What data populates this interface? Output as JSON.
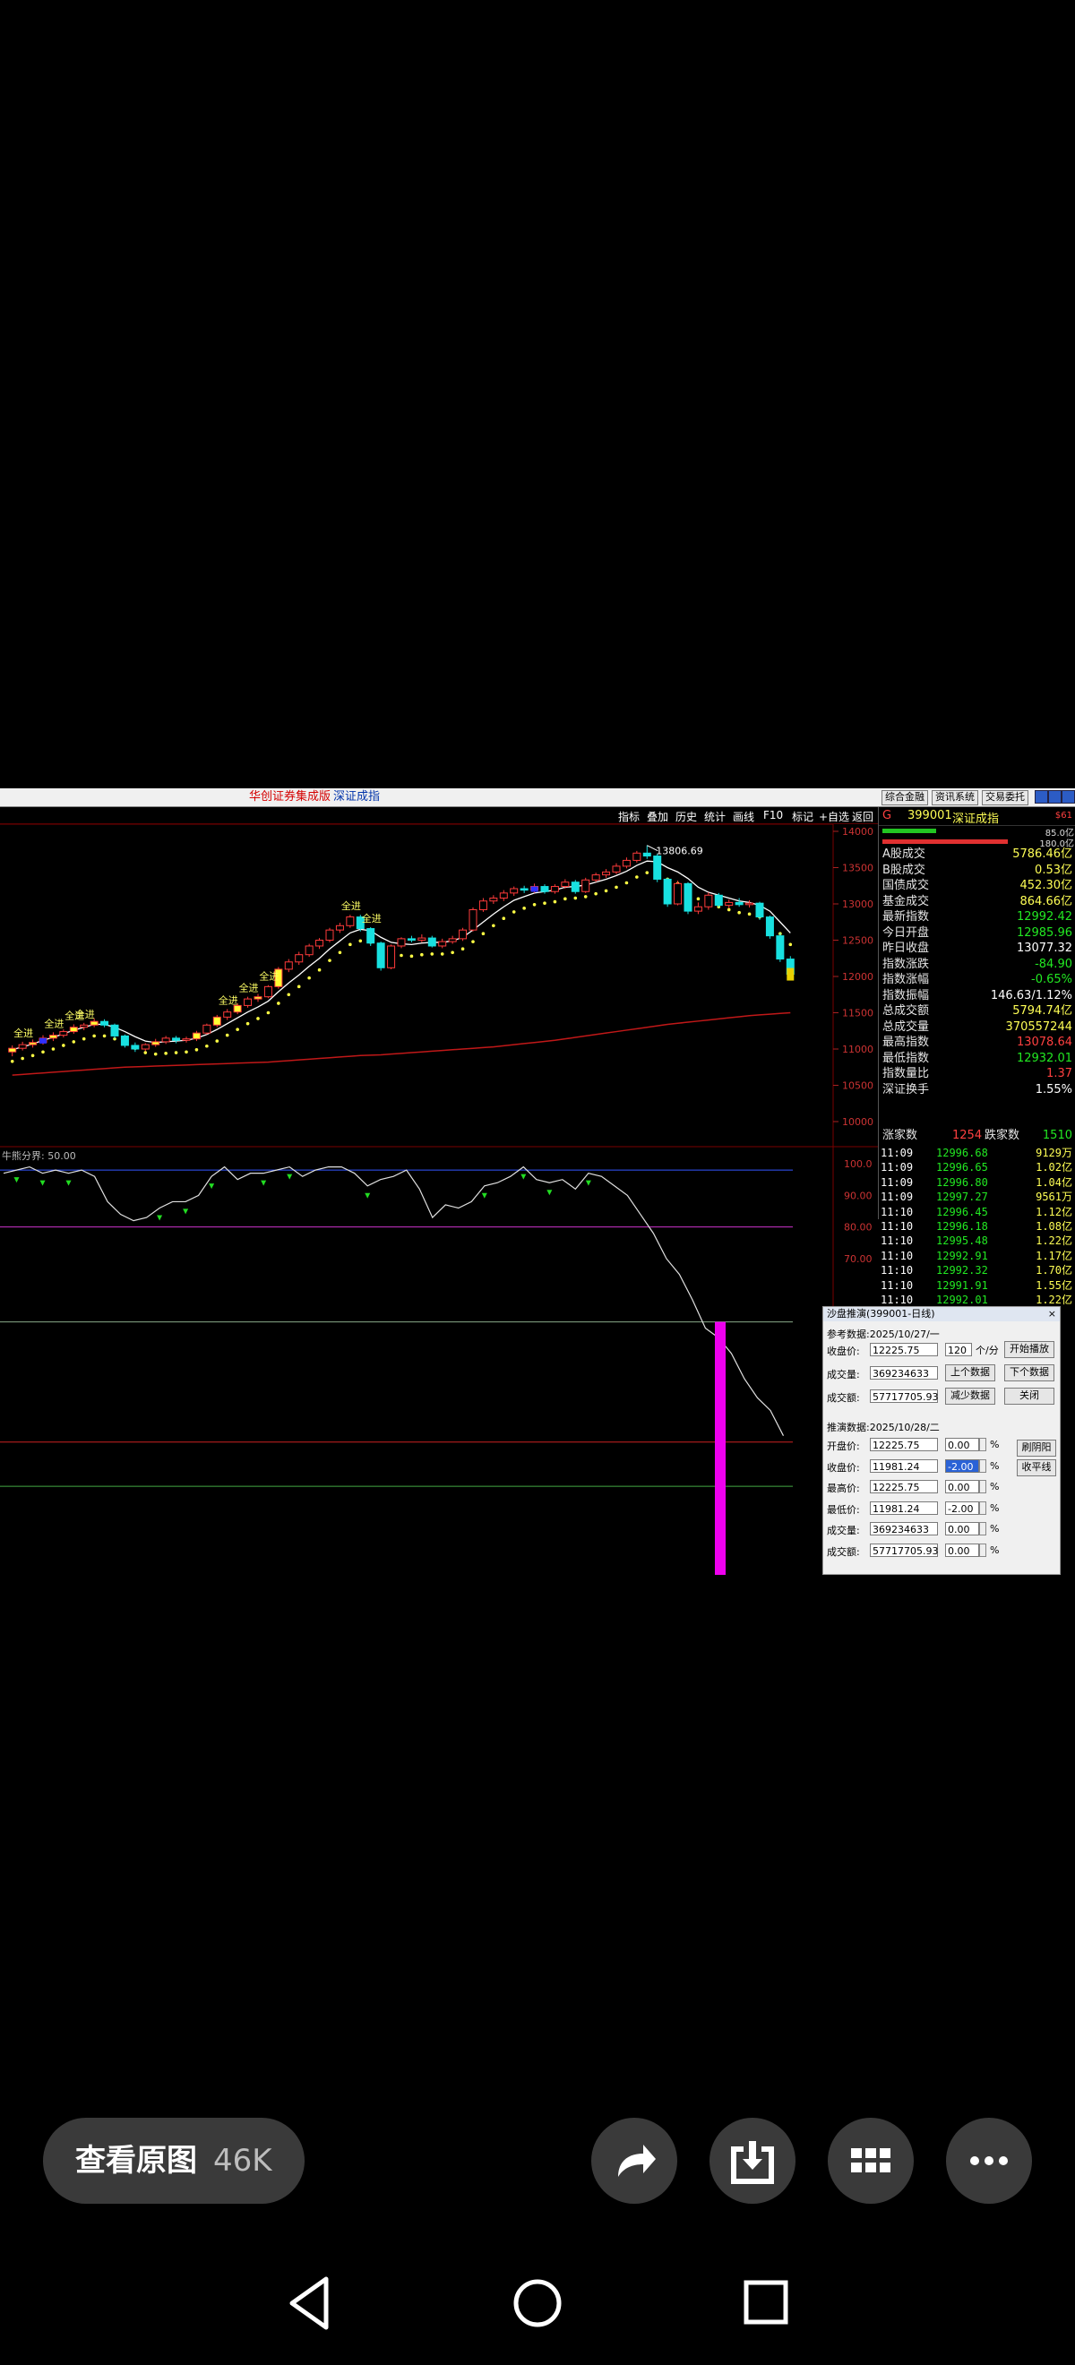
{
  "window": {
    "title_app": "华创证券集成版",
    "title_index": "深证成指",
    "buttons": [
      "综合金融",
      "资讯系统",
      "交易委托"
    ]
  },
  "toolbar": {
    "items": [
      "指标",
      "叠加",
      "历史",
      "统计",
      "画线",
      "F10",
      "标记",
      "+自选",
      "返回"
    ]
  },
  "chart": {
    "high_label": "13806.69",
    "price_ticks": [
      "14000",
      "13500",
      "13000",
      "12500",
      "12000",
      "11500",
      "11000",
      "10500",
      "10000"
    ],
    "signal_label": "全进",
    "indicator_label": "牛熊分界: 50.00",
    "indicator_ticks": [
      "100.0",
      "90.00",
      "80.00",
      "70.00"
    ]
  },
  "chart_data": {
    "type": "line",
    "title": "",
    "xlabel": "",
    "ylabel": "",
    "ylim": [
      10000,
      14000
    ],
    "candles": [
      [
        10960,
        11010,
        10900,
        11050
      ],
      [
        11010,
        11060,
        10980,
        11100
      ],
      [
        11060,
        11090,
        11020,
        11130
      ],
      [
        11090,
        11150,
        11060,
        11190
      ],
      [
        11150,
        11190,
        11110,
        11230
      ],
      [
        11190,
        11240,
        11160,
        11270
      ],
      [
        11240,
        11300,
        11210,
        11340
      ],
      [
        11300,
        11330,
        11260,
        11360
      ],
      [
        11330,
        11380,
        11300,
        11420
      ],
      [
        11380,
        11330,
        11300,
        11410
      ],
      [
        11330,
        11180,
        11140,
        11350
      ],
      [
        11180,
        11050,
        11020,
        11200
      ],
      [
        11050,
        11000,
        10960,
        11090
      ],
      [
        11000,
        11060,
        10970,
        11080
      ],
      [
        11060,
        11100,
        11030,
        11140
      ],
      [
        11100,
        11150,
        11070,
        11180
      ],
      [
        11150,
        11120,
        11080,
        11180
      ],
      [
        11120,
        11140,
        11090,
        11170
      ],
      [
        11140,
        11220,
        11110,
        11250
      ],
      [
        11220,
        11330,
        11200,
        11350
      ],
      [
        11330,
        11440,
        11300,
        11470
      ],
      [
        11440,
        11510,
        11400,
        11550
      ],
      [
        11510,
        11600,
        11480,
        11630
      ],
      [
        11600,
        11690,
        11570,
        11720
      ],
      [
        11690,
        11720,
        11650,
        11760
      ],
      [
        11720,
        11860,
        11700,
        11880
      ],
      [
        11860,
        12100,
        11830,
        12130
      ],
      [
        12100,
        12200,
        12060,
        12240
      ],
      [
        12200,
        12300,
        12160,
        12340
      ],
      [
        12300,
        12420,
        12270,
        12450
      ],
      [
        12420,
        12500,
        12380,
        12530
      ],
      [
        12500,
        12640,
        12470,
        12670
      ],
      [
        12640,
        12700,
        12600,
        12740
      ],
      [
        12700,
        12820,
        12670,
        12850
      ],
      [
        12820,
        12660,
        12620,
        12850
      ],
      [
        12660,
        12460,
        12420,
        12680
      ],
      [
        12460,
        12120,
        12080,
        12480
      ],
      [
        12120,
        12420,
        12100,
        12440
      ],
      [
        12420,
        12520,
        12390,
        12540
      ],
      [
        12520,
        12500,
        12470,
        12560
      ],
      [
        12500,
        12530,
        12470,
        12580
      ],
      [
        12530,
        12420,
        12400,
        12560
      ],
      [
        12420,
        12480,
        12390,
        12520
      ],
      [
        12480,
        12520,
        12450,
        12560
      ],
      [
        12520,
        12640,
        12490,
        12670
      ],
      [
        12640,
        12920,
        12620,
        12950
      ],
      [
        12920,
        13040,
        12890,
        13080
      ],
      [
        13040,
        13080,
        13000,
        13120
      ],
      [
        13080,
        13150,
        13040,
        13190
      ],
      [
        13150,
        13210,
        13110,
        13240
      ],
      [
        13210,
        13190,
        13150,
        13250
      ],
      [
        13190,
        13240,
        13150,
        13280
      ],
      [
        13240,
        13170,
        13140,
        13270
      ],
      [
        13170,
        13240,
        13140,
        13270
      ],
      [
        13240,
        13300,
        13210,
        13340
      ],
      [
        13300,
        13170,
        13140,
        13330
      ],
      [
        13170,
        13330,
        13150,
        13360
      ],
      [
        13330,
        13400,
        13300,
        13430
      ],
      [
        13400,
        13440,
        13360,
        13480
      ],
      [
        13440,
        13520,
        13410,
        13560
      ],
      [
        13520,
        13600,
        13490,
        13640
      ],
      [
        13600,
        13700,
        13570,
        13730
      ],
      [
        13700,
        13660,
        13620,
        13806.69
      ],
      [
        13660,
        13340,
        13300,
        13690
      ],
      [
        13340,
        13000,
        12960,
        13360
      ],
      [
        13000,
        13280,
        12980,
        13320
      ],
      [
        13280,
        12900,
        12860,
        13300
      ],
      [
        12900,
        12960,
        12860,
        13020
      ],
      [
        12960,
        13120,
        12920,
        13160
      ],
      [
        13120,
        12980,
        12950,
        13150
      ],
      [
        12980,
        13020,
        12940,
        13060
      ],
      [
        13020,
        12990,
        12960,
        13080
      ],
      [
        12990,
        13010,
        12950,
        13050
      ],
      [
        13010,
        12820,
        12780,
        13030
      ],
      [
        12820,
        12560,
        12520,
        12840
      ],
      [
        12560,
        12240,
        12200,
        12600
      ],
      [
        12240,
        12030,
        11980,
        12280
      ]
    ],
    "ma_short": [
      10990,
      11030,
      11070,
      11120,
      11160,
      11210,
      11260,
      11300,
      11340,
      11340,
      11300,
      11240,
      11170,
      11110,
      11090,
      11100,
      11110,
      11120,
      11150,
      11200,
      11270,
      11350,
      11430,
      11510,
      11580,
      11660,
      11790,
      11910,
      12020,
      12140,
      12250,
      12380,
      12490,
      12600,
      12650,
      12630,
      12540,
      12470,
      12450,
      12440,
      12460,
      12470,
      12470,
      12490,
      12540,
      12640,
      12750,
      12860,
      12960,
      13050,
      13100,
      13150,
      13170,
      13190,
      13230,
      13240,
      13260,
      13300,
      13340,
      13390,
      13450,
      13530,
      13590,
      13580,
      13500,
      13440,
      13350,
      13230,
      13160,
      13120,
      13080,
      13040,
      13020,
      12980,
      12900,
      12750,
      12600
    ],
    "ma_long": [
      10640,
      10650,
      10660,
      10670,
      10680,
      10690,
      10700,
      10710,
      10720,
      10730,
      10740,
      10750,
      10755,
      10760,
      10765,
      10770,
      10775,
      10780,
      10785,
      10790,
      10795,
      10800,
      10805,
      10810,
      10815,
      10820,
      10830,
      10840,
      10850,
      10860,
      10870,
      10880,
      10890,
      10900,
      10910,
      10915,
      10920,
      10930,
      10940,
      10950,
      10960,
      10970,
      10980,
      10990,
      11000,
      11010,
      11020,
      11030,
      11045,
      11060,
      11075,
      11090,
      11105,
      11120,
      11140,
      11160,
      11180,
      11200,
      11220,
      11240,
      11260,
      11280,
      11300,
      11320,
      11340,
      11355,
      11370,
      11385,
      11400,
      11415,
      11430,
      11445,
      11460,
      11470,
      11480,
      11490,
      11500
    ],
    "indicator": [
      97,
      98,
      99,
      97,
      98,
      97,
      98,
      96,
      88,
      84,
      82,
      83,
      86,
      88,
      88,
      90,
      96,
      99,
      95,
      97,
      97,
      98,
      99,
      96,
      98,
      99,
      99,
      97,
      93,
      95,
      96,
      98,
      92,
      83,
      87,
      86,
      88,
      93,
      94,
      96,
      99,
      95,
      94,
      95,
      92,
      97,
      96,
      93,
      90,
      84,
      78,
      70,
      65,
      57,
      48,
      45,
      40,
      32,
      26,
      22,
      14
    ]
  },
  "quote": {
    "code_prefix": "G",
    "code": "399001",
    "name": "深证成指",
    "tag": "$61",
    "top_nums": [
      "85.0亿",
      "180.0亿"
    ],
    "rows": [
      {
        "label": "A股成交",
        "value": "5786.46亿",
        "color": "#ffff55"
      },
      {
        "label": "B股成交",
        "value": "0.53亿",
        "color": "#ffff55"
      },
      {
        "label": "国债成交",
        "value": "452.30亿",
        "color": "#ffff55"
      },
      {
        "label": "基金成交",
        "value": "864.66亿",
        "color": "#ffff55"
      },
      {
        "label": "最新指数",
        "value": "12992.42",
        "color": "#22e822"
      },
      {
        "label": "今日开盘",
        "value": "12985.96",
        "color": "#22e822"
      },
      {
        "label": "昨日收盘",
        "value": "13077.32",
        "color": "#ffffff"
      },
      {
        "label": "指数涨跌",
        "value": "-84.90",
        "color": "#22e822"
      },
      {
        "label": "指数涨幅",
        "value": "-0.65%",
        "color": "#22e822"
      },
      {
        "label": "指数振幅",
        "value": "146.63/1.12%",
        "color": "#ffffff"
      },
      {
        "label": "总成交额",
        "value": "5794.74亿",
        "color": "#ffff55"
      },
      {
        "label": "总成交量",
        "value": "370557244",
        "color": "#ffff55"
      },
      {
        "label": "最高指数",
        "value": "13078.64",
        "color": "#ff4040"
      },
      {
        "label": "最低指数",
        "value": "12932.01",
        "color": "#22e822"
      },
      {
        "label": "指数量比",
        "value": "1.37",
        "color": "#ff4040"
      },
      {
        "label": "深证换手",
        "value": "1.55%",
        "color": "#ffffff"
      }
    ],
    "adv_label": "涨家数",
    "adv_value": "1254",
    "dec_label": "跌家数",
    "dec_value": "1510",
    "ticks": [
      {
        "time": "11:09",
        "price": "12996.68",
        "vol": "9129万"
      },
      {
        "time": "11:09",
        "price": "12996.65",
        "vol": "1.02亿"
      },
      {
        "time": "11:09",
        "price": "12996.80",
        "vol": "1.04亿"
      },
      {
        "time": "11:09",
        "price": "12997.27",
        "vol": "9561万"
      },
      {
        "time": "11:10",
        "price": "12996.45",
        "vol": "1.12亿"
      },
      {
        "time": "11:10",
        "price": "12996.18",
        "vol": "1.08亿"
      },
      {
        "time": "11:10",
        "price": "12995.48",
        "vol": "1.22亿"
      },
      {
        "time": "11:10",
        "price": "12992.91",
        "vol": "1.17亿"
      },
      {
        "time": "11:10",
        "price": "12992.32",
        "vol": "1.70亿"
      },
      {
        "time": "11:10",
        "price": "12991.91",
        "vol": "1.55亿"
      },
      {
        "time": "11:10",
        "price": "12992.01",
        "vol": "1.22亿"
      }
    ]
  },
  "dialog": {
    "title": "沙盘推演(399001-日线)",
    "ref_header": "参考数据:2025/10/27/一",
    "ref": [
      {
        "label": "收盘价:",
        "value": "12225.75"
      },
      {
        "label": "成交量:",
        "value": "369234633"
      },
      {
        "label": "成交额:",
        "value": "57717705.93"
      }
    ],
    "speed_value": "120",
    "speed_unit": "个/分",
    "btn_play": "开始播放",
    "btn_prev": "上个数据",
    "btn_next": "下个数据",
    "btn_less": "减少数据",
    "btn_close": "关闭",
    "sim_header": "推演数据:2025/10/28/二",
    "sim": [
      {
        "label": "开盘价:",
        "value": "12225.75",
        "pct": "0.00"
      },
      {
        "label": "收盘价:",
        "value": "11981.24",
        "pct": "-2.00"
      },
      {
        "label": "最高价:",
        "value": "12225.75",
        "pct": "0.00"
      },
      {
        "label": "最低价:",
        "value": "11981.24",
        "pct": "-2.00"
      },
      {
        "label": "成交量:",
        "value": "369234633",
        "pct": "0.00"
      },
      {
        "label": "成交额:",
        "value": "57717705.93",
        "pct": "0.00"
      }
    ],
    "pct_sign": "%",
    "btn_yinyang": "刷阴阳",
    "btn_flat": "收平线"
  },
  "viewer": {
    "view_original": "查看原图",
    "size": "46K",
    "icons": [
      "share-icon",
      "download-icon",
      "grid-icon",
      "more-icon"
    ]
  },
  "nav": {
    "icons": [
      "back-icon",
      "home-icon",
      "recents-icon"
    ]
  }
}
